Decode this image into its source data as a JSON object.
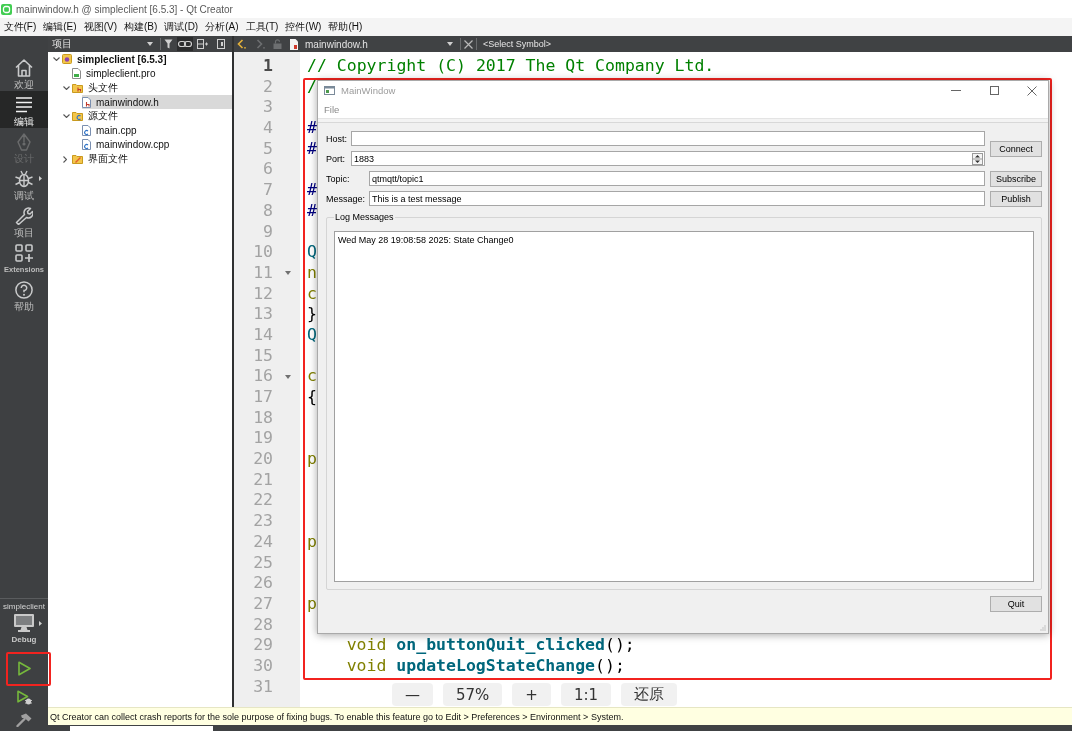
{
  "window": {
    "title": "mainwindow.h @ simpleclient [6.5.3] - Qt Creator"
  },
  "menu_bar": [
    "文件(F)",
    "编辑(E)",
    "视图(V)",
    "构建(B)",
    "调试(D)",
    "分析(A)",
    "工具(T)",
    "控件(W)",
    "帮助(H)"
  ],
  "mode_bar": {
    "modes": [
      {
        "kind": "welcome",
        "label": "欢迎",
        "selected": false,
        "disabled": false,
        "has_menu": false
      },
      {
        "kind": "edit",
        "label": "编辑",
        "selected": true,
        "disabled": false,
        "has_menu": false
      },
      {
        "kind": "design",
        "label": "设计",
        "selected": false,
        "disabled": true,
        "has_menu": false
      },
      {
        "kind": "debug",
        "label": "调试",
        "selected": false,
        "disabled": false,
        "has_menu": true
      },
      {
        "kind": "projects",
        "label": "项目",
        "selected": false,
        "disabled": false,
        "has_menu": false
      },
      {
        "kind": "extensions",
        "label": "Extensions",
        "selected": false,
        "disabled": false,
        "has_menu": false
      },
      {
        "kind": "help",
        "label": "帮助",
        "selected": false,
        "disabled": false,
        "has_menu": false
      }
    ],
    "kit": {
      "project": "simpleclient",
      "build": "Debug"
    },
    "actions": [
      {
        "kind": "run",
        "highlighted": true
      },
      {
        "kind": "debug",
        "highlighted": false
      },
      {
        "kind": "build",
        "highlighted": false
      }
    ]
  },
  "project_pane": {
    "title": "项目",
    "link_active": true,
    "tree": [
      {
        "kind": "project",
        "label": "simpleclient [6.5.3]",
        "expanded": true,
        "selected": false,
        "children": [
          {
            "kind": "pro",
            "label": "simpleclient.pro",
            "selected": false
          },
          {
            "kind": "headers",
            "label": "头文件",
            "expanded": true,
            "selected": false,
            "children": [
              {
                "kind": "header",
                "label": "mainwindow.h",
                "selected": true
              }
            ]
          },
          {
            "kind": "sources",
            "label": "源文件",
            "expanded": true,
            "selected": false,
            "children": [
              {
                "kind": "source",
                "label": "main.cpp",
                "selected": false
              },
              {
                "kind": "source",
                "label": "mainwindow.cpp",
                "selected": false
              }
            ]
          },
          {
            "kind": "forms",
            "label": "界面文件",
            "expanded": false,
            "selected": false
          }
        ]
      }
    ]
  },
  "editor": {
    "file": "mainwindow.h",
    "symbol": "<Select Symbol>",
    "can_go_back": true,
    "can_go_forward": false,
    "lines": [
      {
        "number": "1",
        "current": true,
        "foldable": false,
        "indented": false,
        "tokens": [
          {
            "kind": "comment",
            "text": "// Copyright (C) 2017 The Qt Company Ltd."
          }
        ]
      },
      {
        "number": "2",
        "current": false,
        "foldable": false,
        "indented": false,
        "tokens": [
          {
            "kind": "comment",
            "text": "/"
          }
        ]
      },
      {
        "number": "3",
        "current": false,
        "foldable": false
      },
      {
        "number": "4",
        "current": false,
        "foldable": false,
        "indented": false,
        "tokens": [
          {
            "kind": "preprocessor",
            "text": "#"
          }
        ]
      },
      {
        "number": "5",
        "current": false,
        "foldable": false,
        "indented": false,
        "tokens": [
          {
            "kind": "preprocessor",
            "text": "#"
          }
        ]
      },
      {
        "number": "6",
        "current": false,
        "foldable": false
      },
      {
        "number": "7",
        "current": false,
        "foldable": false,
        "indented": false,
        "tokens": [
          {
            "kind": "preprocessor",
            "text": "#"
          }
        ]
      },
      {
        "number": "8",
        "current": false,
        "foldable": false,
        "indented": false,
        "tokens": [
          {
            "kind": "preprocessor",
            "text": "#"
          }
        ]
      },
      {
        "number": "9",
        "current": false,
        "foldable": false
      },
      {
        "number": "10",
        "current": false,
        "foldable": false,
        "indented": false,
        "tokens": [
          {
            "kind": "macro",
            "text": "Q"
          }
        ]
      },
      {
        "number": "11",
        "current": false,
        "foldable": true,
        "indented": false,
        "tokens": [
          {
            "kind": "keyword",
            "text": "n"
          }
        ]
      },
      {
        "number": "12",
        "current": false,
        "foldable": false,
        "indented": false,
        "tokens": [
          {
            "kind": "keyword",
            "text": "c"
          }
        ]
      },
      {
        "number": "13",
        "current": false,
        "foldable": false,
        "indented": false,
        "tokens": [
          {
            "kind": "plain",
            "text": "}"
          }
        ]
      },
      {
        "number": "14",
        "current": false,
        "foldable": false,
        "indented": false,
        "tokens": [
          {
            "kind": "macro",
            "text": "Q"
          }
        ]
      },
      {
        "number": "15",
        "current": false,
        "foldable": false
      },
      {
        "number": "16",
        "current": false,
        "foldable": true,
        "indented": false,
        "tokens": [
          {
            "kind": "keyword",
            "text": "c"
          }
        ]
      },
      {
        "number": "17",
        "current": false,
        "foldable": false,
        "indented": false,
        "tokens": [
          {
            "kind": "plain",
            "text": "{"
          }
        ]
      },
      {
        "number": "18",
        "current": false,
        "foldable": false
      },
      {
        "number": "19",
        "current": false,
        "foldable": false
      },
      {
        "number": "20",
        "current": false,
        "foldable": false,
        "indented": false,
        "tokens": [
          {
            "kind": "keyword",
            "text": "p"
          }
        ]
      },
      {
        "number": "21",
        "current": false,
        "foldable": false
      },
      {
        "number": "22",
        "current": false,
        "foldable": false
      },
      {
        "number": "23",
        "current": false,
        "foldable": false
      },
      {
        "number": "24",
        "current": false,
        "foldable": false,
        "indented": false,
        "tokens": [
          {
            "kind": "keyword",
            "text": "p"
          }
        ]
      },
      {
        "number": "25",
        "current": false,
        "foldable": false
      },
      {
        "number": "26",
        "current": false,
        "foldable": false
      },
      {
        "number": "27",
        "current": false,
        "foldable": false,
        "indented": false,
        "tokens": [
          {
            "kind": "keyword",
            "text": "p"
          }
        ]
      },
      {
        "number": "28",
        "current": false,
        "foldable": false
      },
      {
        "number": "29",
        "current": false,
        "foldable": false,
        "indented": true,
        "tokens": [
          {
            "kind": "keyword",
            "text": "void "
          },
          {
            "kind": "function",
            "text": "on_buttonQuit_clicked"
          },
          {
            "kind": "plain",
            "text": "();"
          }
        ]
      },
      {
        "number": "30",
        "current": false,
        "foldable": false,
        "indented": true,
        "tokens": [
          {
            "kind": "keyword",
            "text": "void "
          },
          {
            "kind": "function",
            "text": "updateLogStateChange"
          },
          {
            "kind": "plain",
            "text": "();"
          }
        ]
      },
      {
        "number": "31",
        "current": false,
        "foldable": false
      }
    ]
  },
  "app_window": {
    "title": "MainWindow",
    "highlighted": true,
    "menu": [
      "File"
    ],
    "host": {
      "label": "Host:"
    },
    "port": {
      "label": "Port:",
      "value": "1883"
    },
    "connect_button": "Connect",
    "rows": [
      {
        "label": "Topic:",
        "value": "qtmqtt/topic1",
        "button": "Subscribe"
      },
      {
        "label": "Message:",
        "value": "This is a test message",
        "button": "Publish"
      }
    ],
    "log": {
      "title": "Log Messages",
      "lines": [
        "Wed May 28 19:08:58 2025: State Change0"
      ]
    },
    "quit_button": "Quit"
  },
  "notification": {
    "text": "Qt Creator can collect crash reports for the sole purpose of fixing bugs. To enable this feature go to Edit > Preferences > Environment > System."
  },
  "viewer_zoom_bar": [
    "—",
    "57%",
    "+",
    "1:1",
    "还原"
  ]
}
